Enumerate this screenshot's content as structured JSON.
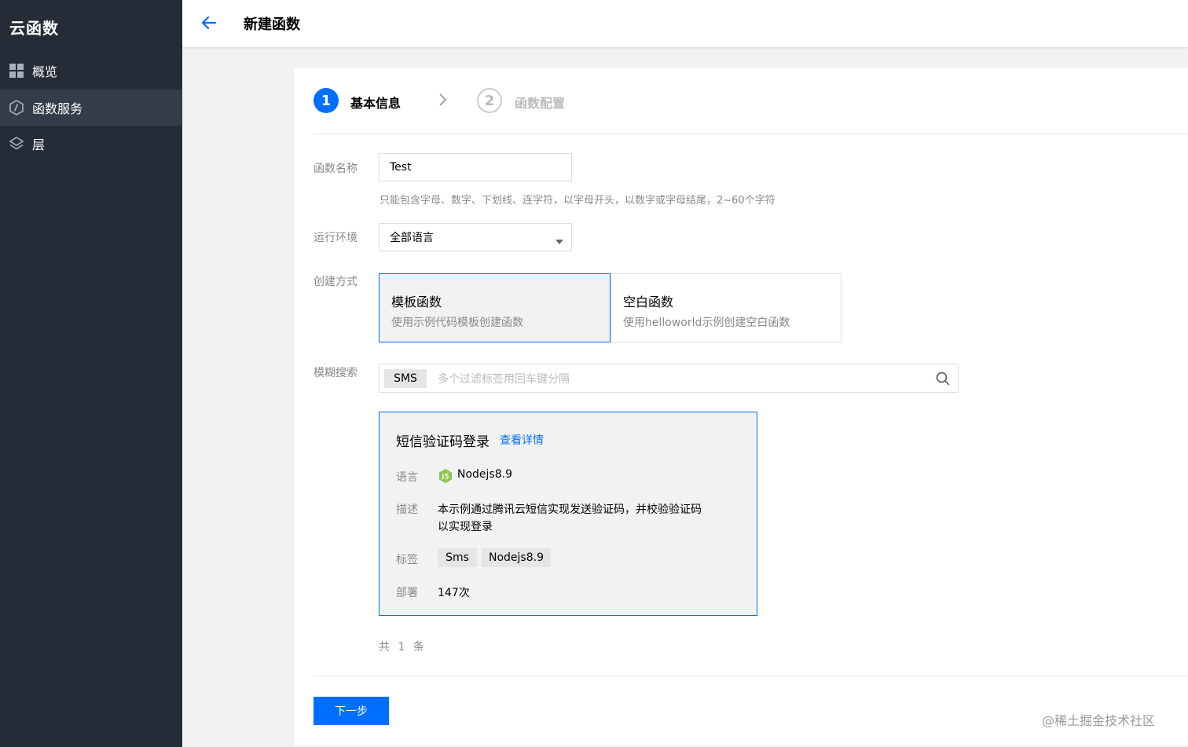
{
  "sidebar": {
    "brand": "云函数",
    "items": [
      {
        "label": "概览",
        "icon": "grid-icon"
      },
      {
        "label": "函数服务",
        "icon": "function-icon"
      },
      {
        "label": "层",
        "icon": "layers-icon"
      }
    ]
  },
  "header": {
    "title": "新建函数"
  },
  "steps": [
    {
      "number": "1",
      "label": "基本信息"
    },
    {
      "number": "2",
      "label": "函数配置"
    }
  ],
  "form": {
    "name": {
      "label": "函数名称",
      "value": "Test",
      "hint": "只能包含字母、数字、下划线、连字符，以字母开头，以数字或字母结尾，2~60个字符"
    },
    "runtime": {
      "label": "运行环境",
      "value": "全部语言"
    },
    "create_method": {
      "label": "创建方式",
      "options": [
        {
          "title": "模板函数",
          "desc": "使用示例代码模板创建函数",
          "selected": true
        },
        {
          "title": "空白函数",
          "desc": "使用helloworld示例创建空白函数",
          "selected": false
        }
      ]
    },
    "search": {
      "label": "模糊搜索",
      "tag": "SMS",
      "placeholder": "多个过滤标签用回车键分隔"
    }
  },
  "template": {
    "title": "短信验证码登录",
    "detail_link": "查看详情",
    "lang_key": "语言",
    "lang_value": "Nodejs8.9",
    "desc_key": "描述",
    "desc_line1": "本示例通过腾讯云短信实现发送验证码，并校验验证码",
    "desc_line2": "以实现登录",
    "tags_key": "标签",
    "tags": [
      "Sms",
      "Nodejs8.9"
    ],
    "deploy_key": "部署",
    "deploy_value": "147次"
  },
  "pagination": {
    "total_prefix": "共",
    "total": "1",
    "total_suffix": "条"
  },
  "footer": {
    "next_label": "下一步"
  },
  "watermark": "@稀土掘金技术社区",
  "colors": {
    "accent": "#006eff",
    "sidebar_bg": "#262c37",
    "sidebar_active": "#343c4b",
    "nodejs_green": "#8cc84b"
  }
}
